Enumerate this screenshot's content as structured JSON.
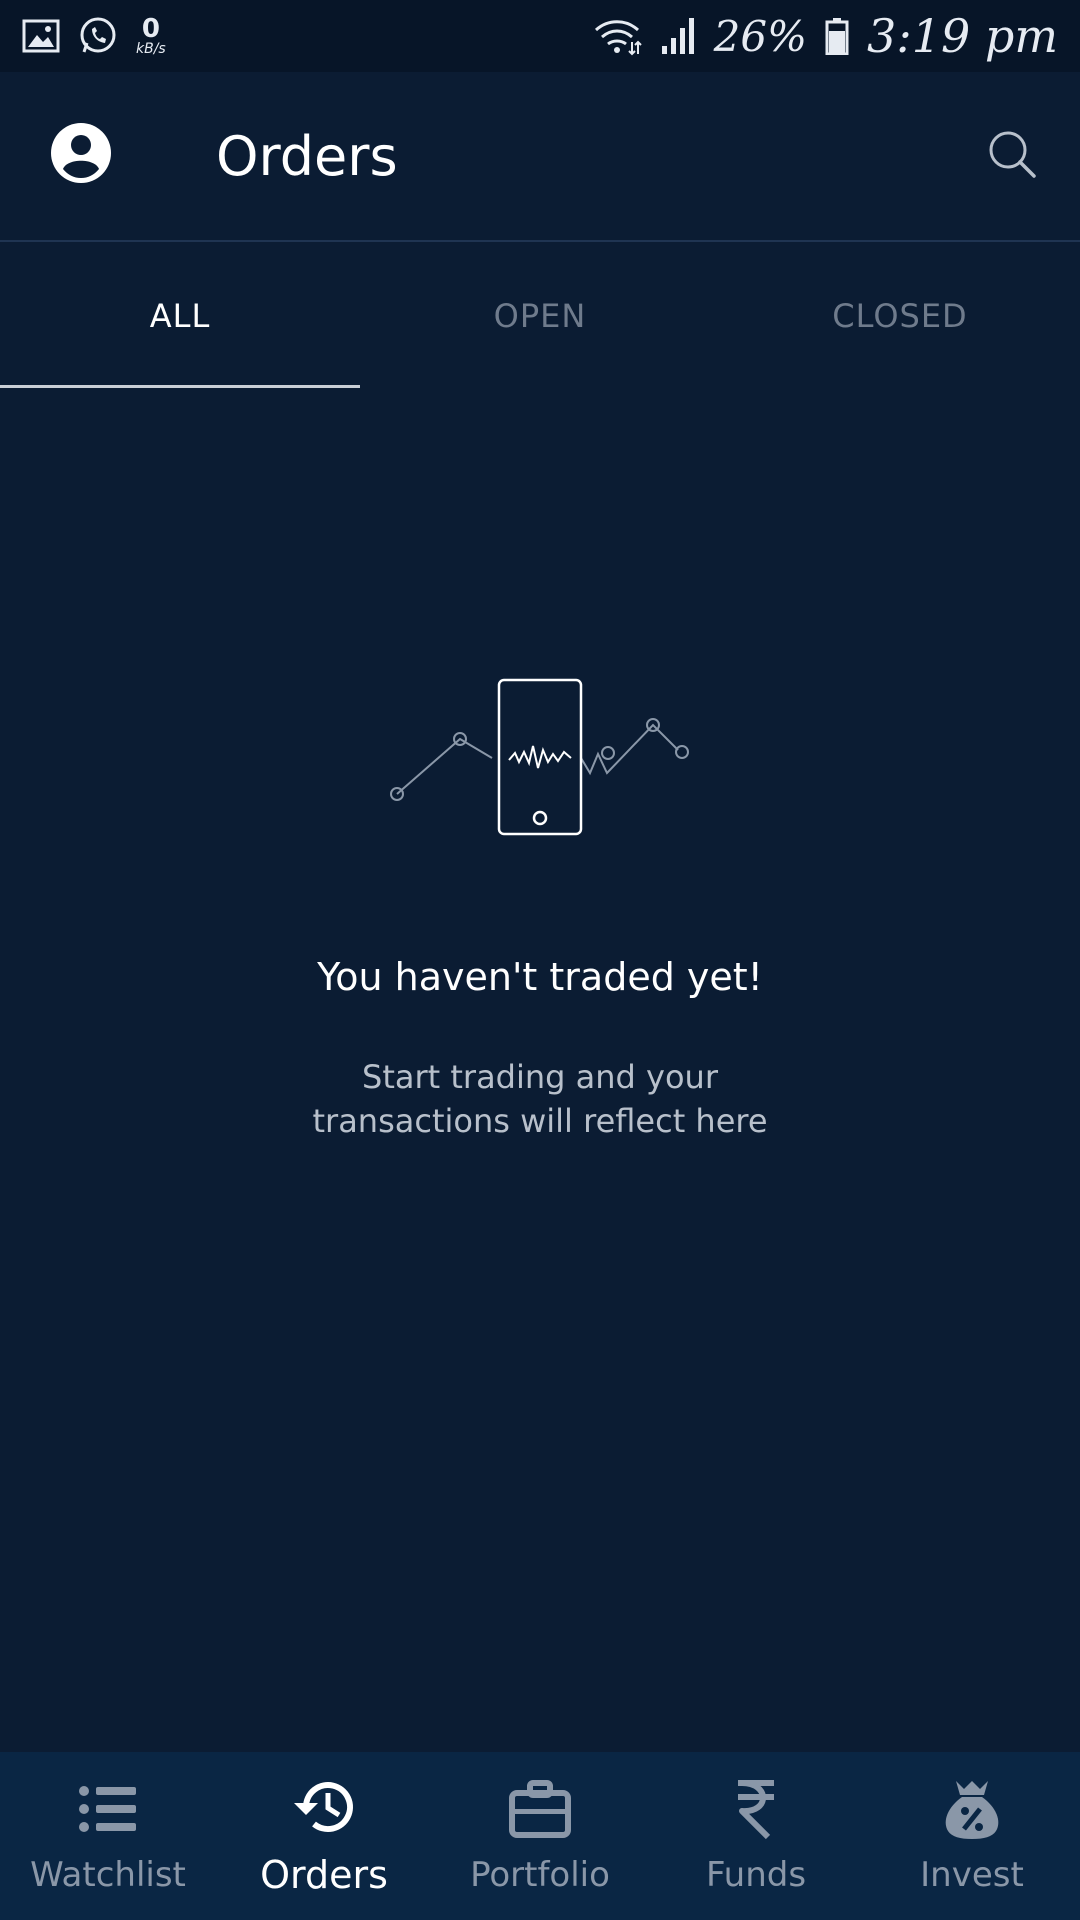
{
  "status_bar": {
    "net_speed_value": "0",
    "net_speed_unit": "kB/s",
    "battery": "26%",
    "time": "3:19 pm"
  },
  "header": {
    "title": "Orders"
  },
  "tabs": [
    {
      "label": "ALL",
      "active": true
    },
    {
      "label": "OPEN",
      "active": false
    },
    {
      "label": "CLOSED",
      "active": false
    }
  ],
  "empty_state": {
    "title": "You haven't traded yet!",
    "subtitle": "Start trading and your transactions will reflect here"
  },
  "bottom_nav": [
    {
      "label": "Watchlist",
      "icon": "list-icon",
      "active": false
    },
    {
      "label": "Orders",
      "icon": "history-icon",
      "active": true
    },
    {
      "label": "Portfolio",
      "icon": "briefcase-icon",
      "active": false
    },
    {
      "label": "Funds",
      "icon": "rupee-icon",
      "active": false
    },
    {
      "label": "Invest",
      "icon": "money-bag-icon",
      "active": false
    }
  ],
  "colors": {
    "background": "#0b1c33",
    "status_bar": "#071528",
    "bottom_nav": "#0a2644",
    "active_text": "#ffffff",
    "inactive_text": "#6f7b8c"
  }
}
